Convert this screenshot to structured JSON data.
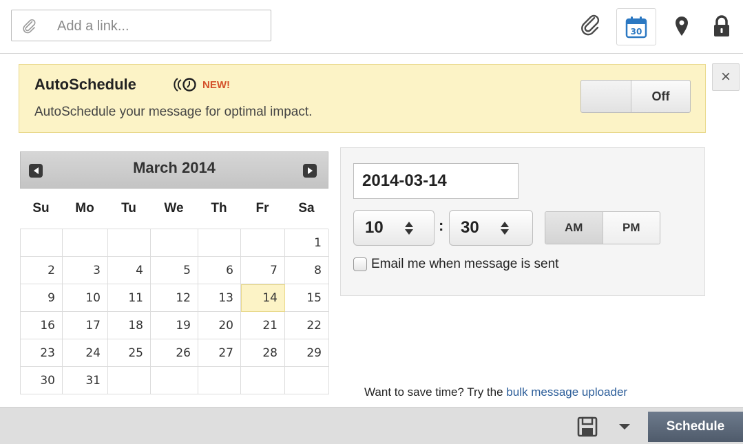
{
  "toolbar": {
    "link_placeholder": "Add a link...",
    "icons": [
      "link-icon",
      "paperclip-icon",
      "calendar-icon",
      "map-pin-icon",
      "lock-icon"
    ],
    "calendar_icon_text": "30"
  },
  "autoschedule": {
    "title": "AutoSchedule",
    "new_badge": "NEW!",
    "description": "AutoSchedule your message for optimal impact.",
    "toggle_label": "Off",
    "close_label": "×"
  },
  "calendar": {
    "month_label": "March 2014",
    "weekdays": [
      "Su",
      "Mo",
      "Tu",
      "We",
      "Th",
      "Fr",
      "Sa"
    ],
    "days": [
      "",
      "",
      "",
      "",
      "",
      "",
      "1",
      "2",
      "3",
      "4",
      "5",
      "6",
      "7",
      "8",
      "9",
      "10",
      "11",
      "12",
      "13",
      "14",
      "15",
      "16",
      "17",
      "18",
      "19",
      "20",
      "21",
      "22",
      "23",
      "24",
      "25",
      "26",
      "27",
      "28",
      "29",
      "30",
      "31",
      "",
      "",
      "",
      "",
      ""
    ],
    "selected_day": "14"
  },
  "time": {
    "date_value": "2014-03-14",
    "hour": "10",
    "minute": "30",
    "separator": ":",
    "am_label": "AM",
    "pm_label": "PM",
    "selected_period": "AM",
    "email_label": "Email me when message is sent",
    "email_checked": false
  },
  "bulk": {
    "prefix": "Want to save time? Try the",
    "link_text": "bulk message uploader"
  },
  "footer": {
    "schedule_label": "Schedule"
  },
  "colors": {
    "banner_bg": "#fcf3c6",
    "new_badge": "#d4502a",
    "link": "#2b5d99",
    "schedule_button": "#5d6979"
  }
}
